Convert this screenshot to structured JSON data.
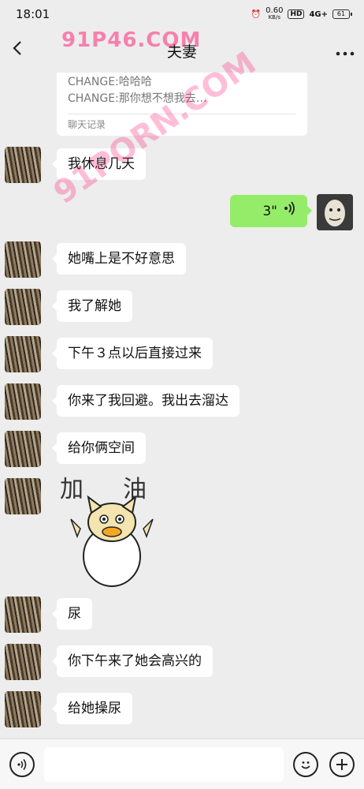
{
  "status": {
    "time": "18:01",
    "net_speed": "0.60",
    "net_unit": "KB/s",
    "hd": "HD",
    "signal": "4G+",
    "battery": "61"
  },
  "header": {
    "title": "夫妻",
    "back_icon": "chevron-left-icon",
    "more_icon": "more-dots-icon"
  },
  "quote": {
    "line1": "CHANGE:哈哈哈",
    "line2": "CHANGE:那你想不想我去…",
    "footer": "聊天记录"
  },
  "messages": [
    {
      "side": "left",
      "text": "我休息几天"
    },
    {
      "side": "right",
      "type": "voice",
      "text": "3\""
    },
    {
      "side": "left",
      "text": "她嘴上是不好意思"
    },
    {
      "side": "left",
      "text": "我了解她"
    },
    {
      "side": "left",
      "text": "下午３点以后直接过来"
    },
    {
      "side": "left",
      "text": "你来了我回避。我出去溜达"
    },
    {
      "side": "left",
      "text": "给你俩空间"
    },
    {
      "side": "left",
      "type": "sticker",
      "text": "加油"
    },
    {
      "side": "left",
      "text": "尿"
    },
    {
      "side": "left",
      "text": "你下午来了她会高兴的"
    },
    {
      "side": "left",
      "text": "给她操尿"
    }
  ],
  "watermarks": {
    "top": "91P46.COM",
    "diagonal": "91PORN.COM"
  },
  "input_bar": {
    "voice_icon": "voice-icon",
    "emoji_icon": "emoji-icon",
    "plus_icon": "plus-icon"
  }
}
